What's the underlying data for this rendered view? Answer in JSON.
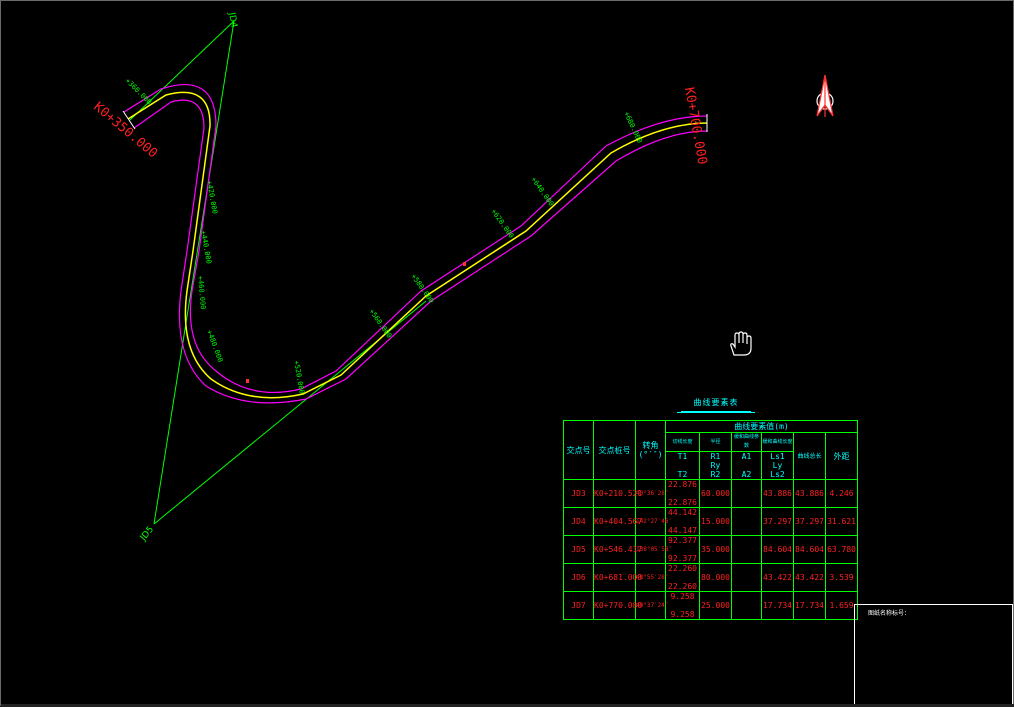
{
  "drawing": {
    "station_start": "K0+350.000",
    "station_end": "K0+700.000",
    "jd_labels": [
      "JD4",
      "JD5"
    ],
    "stations": [
      "+360.000",
      "+420.000",
      "+440.000",
      "+460.000",
      "+480.000",
      "+520.000",
      "+560.000",
      "+580.000",
      "+620.000",
      "+640.000",
      "+680.000"
    ],
    "colors": {
      "background": "#000000",
      "road_center": "#ffff00",
      "road_edge": "#ff00ff",
      "tangent": "#00ff00",
      "station_text": "#00ff00",
      "endpoint_text": "#ff2020"
    }
  },
  "table": {
    "title": "曲线要素表",
    "header": {
      "jd": "交点号",
      "station": "交点桩号",
      "angle": "转角",
      "angle_unit": "(°′″)",
      "group": "曲线要素值(m)",
      "sub1": "切线长度",
      "sub2": "半径",
      "sub3": "缓和曲线参数",
      "sub4": "缓和曲线长度",
      "t1": "T1",
      "t2": "T2",
      "r1": "R1",
      "ry": "Ry",
      "r2": "R2",
      "a1": "A1",
      "a2": "A2",
      "ls1": "Ls1",
      "ly": "Ly",
      "ls2": "Ls2",
      "curve_len": "曲线总长",
      "ext": "外距"
    },
    "rows": [
      {
        "jd": "JD3",
        "station": "K0+210.521",
        "angle": "40°36′28″",
        "t1": "22.876",
        "t2": "22.876",
        "r": "60.000",
        "a": "",
        "ls": "43.886",
        "len": "43.886",
        "e": "4.246"
      },
      {
        "jd": "JD4",
        "station": "K0+404.567",
        "angle": "142°27′46″",
        "t1": "44.142",
        "t2": "44.147",
        "r": "15.000",
        "a": "",
        "ls": "37.297",
        "len": "37.297",
        "e": "31.621"
      },
      {
        "jd": "JD5",
        "station": "K0+546.417",
        "angle": "138°05′58″",
        "t1": "92.377",
        "t2": "92.377",
        "r": "35.000",
        "a": "",
        "ls": "84.604",
        "len": "84.604",
        "e": "63.780"
      },
      {
        "jd": "JD6",
        "station": "K0+681.003",
        "angle": "48°55′28″",
        "t1": "22.260",
        "t2": "22.260",
        "r": "80.000",
        "a": "",
        "ls": "43.422",
        "len": "43.422",
        "e": "3.539"
      },
      {
        "jd": "JD7",
        "station": "K0+770.080",
        "angle": "40°37′24″",
        "t1": "9.258",
        "t2": "9.258",
        "r": "25.000",
        "a": "",
        "ls": "17.734",
        "len": "17.734",
        "e": "1.659"
      }
    ]
  },
  "title_block": {
    "label": "图纸名称标号："
  }
}
